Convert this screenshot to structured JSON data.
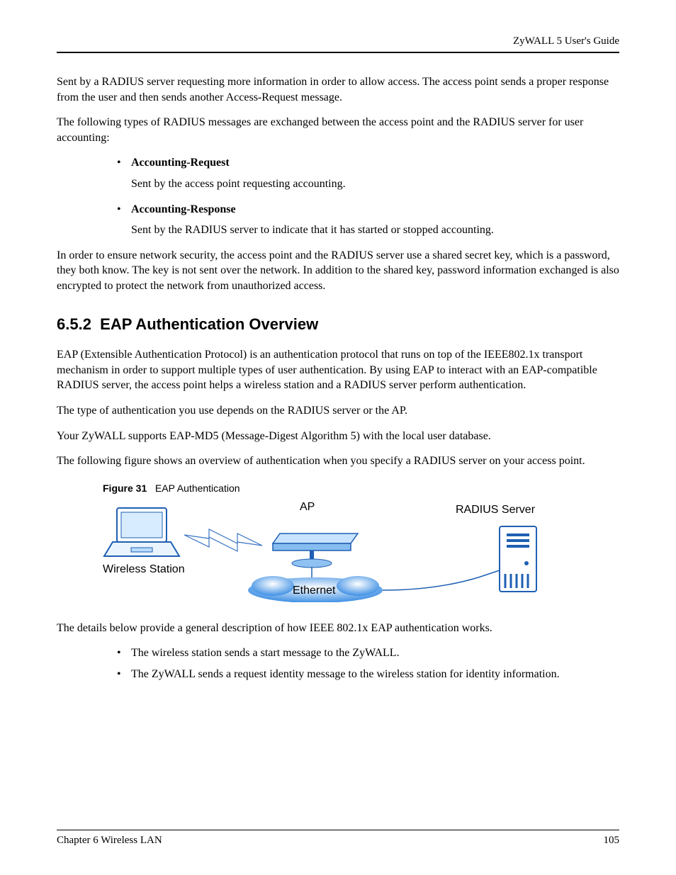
{
  "header": {
    "guide_title": "ZyWALL 5 User's Guide"
  },
  "intro_para": "Sent by a RADIUS server requesting more information in order to allow access. The access point sends a proper response from the user and then sends another Access-Request message.",
  "accounting_intro": "The following types of RADIUS messages are exchanged between the access point and the RADIUS server for user accounting:",
  "bullets_a": [
    {
      "title": "Accounting-Request",
      "desc": "Sent by the access point requesting accounting."
    },
    {
      "title": "Accounting-Response",
      "desc": "Sent by the RADIUS server to indicate that it has started or stopped accounting."
    }
  ],
  "security_para": "In order to ensure network security, the access point and the RADIUS server use a shared secret key, which is a password, they both know. The key is not sent over the network. In addition to the shared key, password information exchanged is also encrypted to protect the network from unauthorized access.",
  "section": {
    "number": "6.5.2",
    "title": "EAP Authentication Overview"
  },
  "eap_p1": "EAP (Extensible Authentication Protocol) is an authentication protocol that runs on top of the IEEE802.1x transport mechanism in order to support multiple types of user authentication. By using EAP to interact with an EAP-compatible RADIUS server, the access point helps a wireless station and a RADIUS server perform authentication.",
  "eap_p2": "The type of authentication you use depends on the RADIUS server or the AP.",
  "eap_p3": "Your ZyWALL supports EAP-MD5 (Message-Digest Algorithm 5) with the local user database.",
  "eap_p4": "The following figure shows an overview of authentication when you specify a RADIUS server on your access point.",
  "figure": {
    "number": "Figure 31",
    "caption": "EAP Authentication",
    "labels": {
      "ap": "AP",
      "radius": "RADIUS Server",
      "wireless": "Wireless Station",
      "ethernet": "Ethernet"
    }
  },
  "post_fig": "The details below provide a general description of how IEEE 802.1x EAP authentication works.",
  "bullets_b": [
    "The wireless station sends a start message to the ZyWALL.",
    "The ZyWALL sends a request identity message to the wireless station for identity information."
  ],
  "footer": {
    "chapter": "Chapter 6 Wireless LAN",
    "page": "105"
  }
}
